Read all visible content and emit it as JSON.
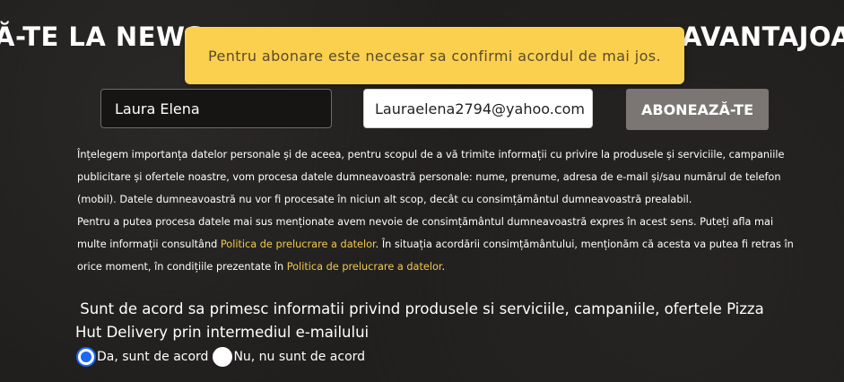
{
  "headline": {
    "left_fragment": "Ă-TE LA NEWS",
    "right_fragment": "AVANTAJOA"
  },
  "toast": {
    "message": "Pentru abonare este necesar sa confirmi acordul de mai jos."
  },
  "form": {
    "name_value": "Laura Elena",
    "email_value": "Lauraelena2794@yahoo.com",
    "subscribe_label": "ABONEAZĂ-TE"
  },
  "privacy": {
    "p1": "Înțelegem importanța datelor personale și de aceea, pentru scopul de a vă trimite informații cu privire la produsele și serviciile, campaniile publicitare și ofertele noastre, vom procesa datele dumneavoastră personale: nume, prenume, adresa de e-mail și/sau numărul de telefon (mobil). Datele dumneavoastră nu vor fi procesate în niciun alt scop, decât cu consimțământul dumneavoastră prealabil.",
    "p2_a": "Pentru a putea procesa datele mai sus menționate avem nevoie de consimțământul dumneavoastră expres în acest sens. Puteți afla mai multe informații consultând ",
    "link1": "Politica de prelucrare a datelor",
    "p2_b": ". În situația acordării consimțământului, menționăm că acesta va putea fi retras în orice moment, în condițiile prezentate în ",
    "link2": "Politica de prelucrare a datelor",
    "p2_c": "."
  },
  "consent": {
    "question": "Sunt de acord sa primesc informatii privind produsele si serviciile, campaniile, ofertele Pizza Hut Delivery prin intermediul e-mailului",
    "option_yes": "Da, sunt de acord",
    "option_no": "Nu, nu sunt de acord",
    "selected": "yes"
  },
  "colors": {
    "toast_bg": "#fbd04f",
    "link": "#f2c94c",
    "radio_accent": "#1e66f5",
    "button_bg": "#7b7674"
  }
}
